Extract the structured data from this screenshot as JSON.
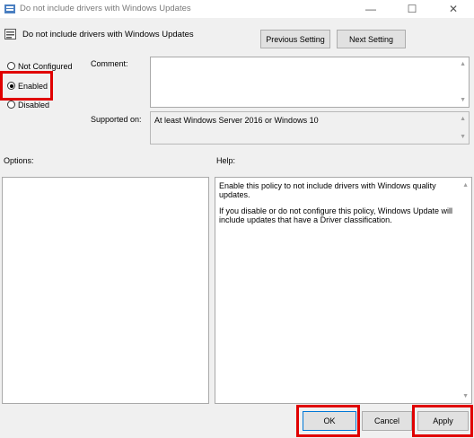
{
  "window": {
    "title": "Do not include drivers with Windows Updates",
    "minimize": "—",
    "maximize": "☐",
    "close": "✕"
  },
  "header": {
    "policy_name": "Do not include drivers with Windows Updates",
    "previous_button": "Previous Setting",
    "next_button": "Next Setting"
  },
  "state": {
    "options": [
      {
        "label": "Not Configured",
        "selected": false
      },
      {
        "label": "Enabled",
        "selected": true
      },
      {
        "label": "Disabled",
        "selected": false
      }
    ]
  },
  "comment": {
    "label": "Comment:",
    "value": ""
  },
  "supported": {
    "label": "Supported on:",
    "value": "At least Windows Server 2016 or Windows 10"
  },
  "options_label": "Options:",
  "help": {
    "label": "Help:",
    "paragraphs": [
      "Enable this policy to not include drivers with Windows quality updates.",
      "If you disable or do not configure this policy, Windows Update will include updates that have a Driver classification."
    ]
  },
  "footer": {
    "ok": "OK",
    "cancel": "Cancel",
    "apply": "Apply"
  },
  "colors": {
    "highlight": "#e00000",
    "background": "#f0f0f0"
  }
}
